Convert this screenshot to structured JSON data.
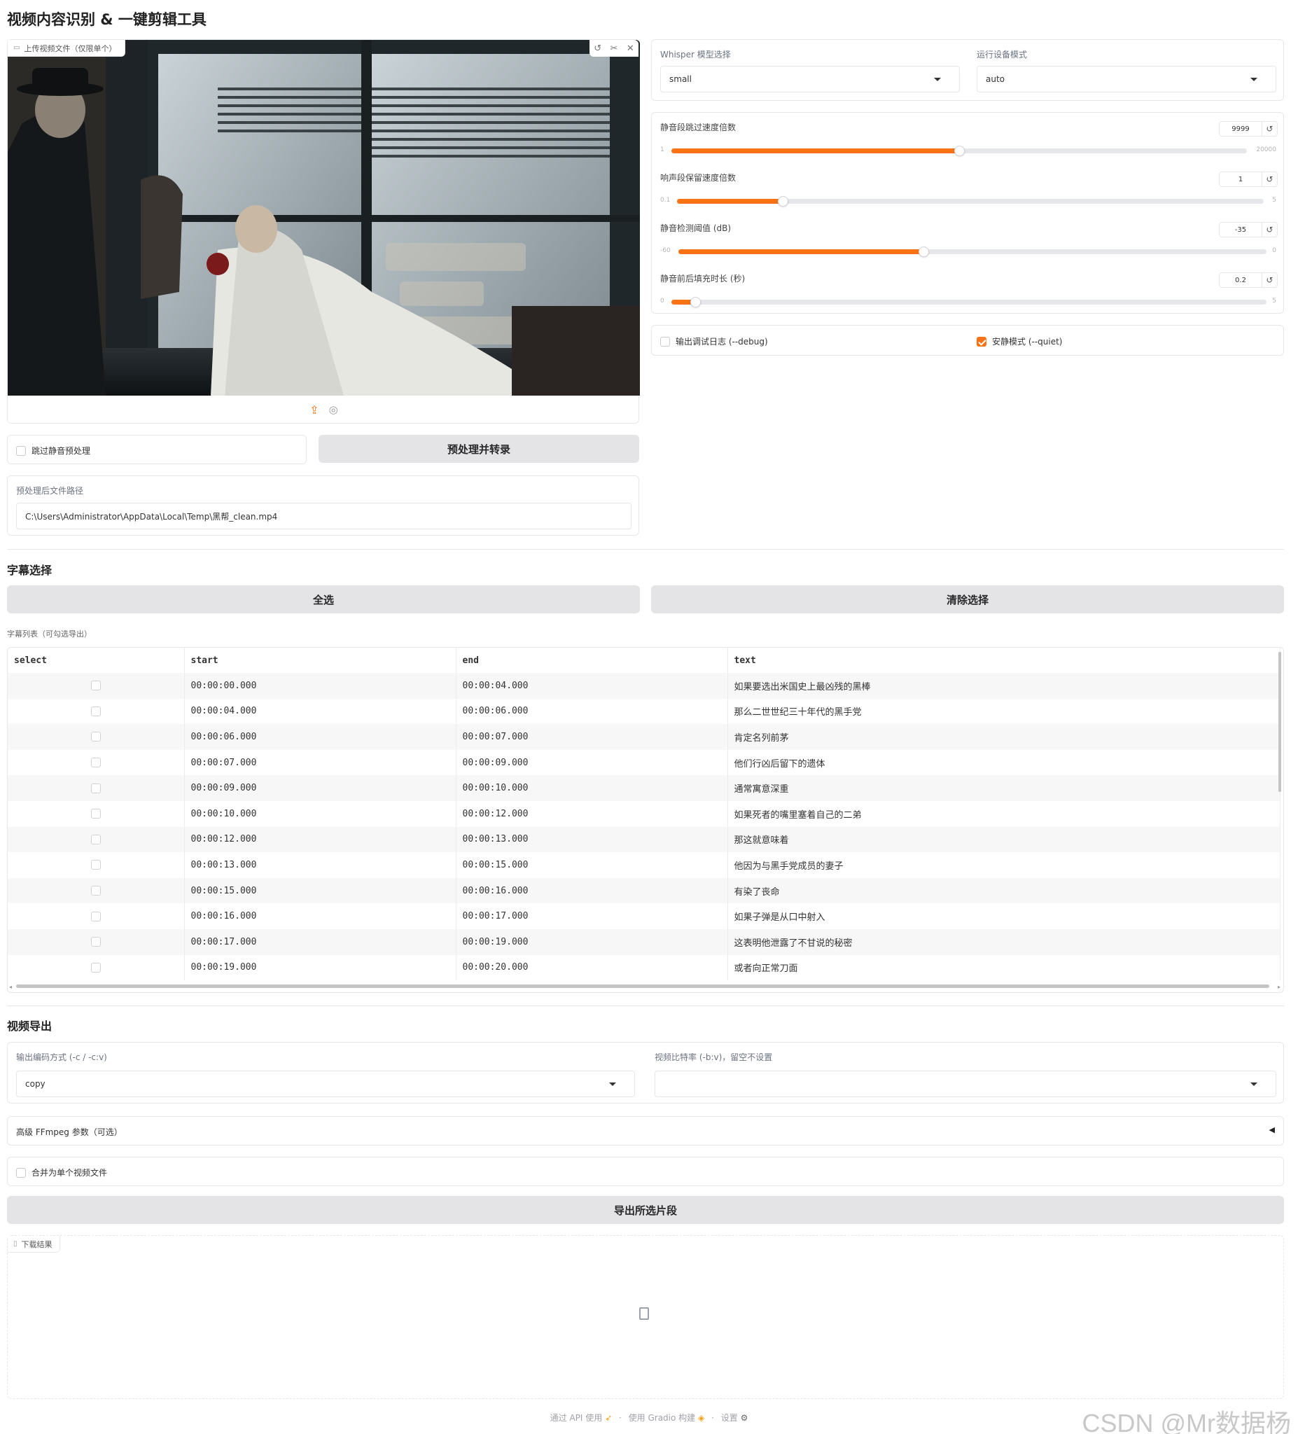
{
  "app": {
    "title": "视频内容识别 & 一键剪辑工具"
  },
  "upload": {
    "label": "上传视频文件（仅限单个）"
  },
  "model": {
    "label": "Whisper 模型选择",
    "value": "small"
  },
  "device": {
    "label": "运行设备模式",
    "value": "auto"
  },
  "sliders": [
    {
      "label": "静音段跳过速度倍数",
      "value": "9999",
      "min": "1",
      "max": "20000",
      "fraction": 0.5
    },
    {
      "label": "响声段保留速度倍数",
      "value": "1",
      "min": "0.1",
      "max": "5",
      "fraction": 0.18
    },
    {
      "label": "静音检测阈值 (dB)",
      "value": "-35",
      "min": "-60",
      "max": "0",
      "fraction": 0.417
    },
    {
      "label": "静音前后填充时长 (秒)",
      "value": "0.2",
      "min": "0",
      "max": "5",
      "fraction": 0.04
    }
  ],
  "options": {
    "debug_label": "输出调试日志 (--debug)",
    "debug_checked": false,
    "quiet_label": "安静模式 (--quiet)",
    "quiet_checked": true
  },
  "preprocess": {
    "skip_label": "跳过静音预处理",
    "button": "预处理并转录"
  },
  "path": {
    "label": "预处理后文件路径",
    "value": "C:\\Users\\Administrator\\AppData\\Local\\Temp\\黑帮_clean.mp4"
  },
  "subtitles": {
    "section_title": "字幕选择",
    "select_all": "全选",
    "clear": "清除选择",
    "list_label": "字幕列表（可勾选导出）",
    "columns": [
      "select",
      "start",
      "end",
      "text"
    ],
    "rows": [
      {
        "start": "00:00:00.000",
        "end": "00:00:04.000",
        "text": "如果要选出米国史上最凶残的黑棒"
      },
      {
        "start": "00:00:04.000",
        "end": "00:00:06.000",
        "text": "那么二世世纪三十年代的黑手党"
      },
      {
        "start": "00:00:06.000",
        "end": "00:00:07.000",
        "text": "肯定名列前茅"
      },
      {
        "start": "00:00:07.000",
        "end": "00:00:09.000",
        "text": "他们行凶后留下的遗体"
      },
      {
        "start": "00:00:09.000",
        "end": "00:00:10.000",
        "text": "通常寓意深重"
      },
      {
        "start": "00:00:10.000",
        "end": "00:00:12.000",
        "text": "如果死者的嘴里塞着自己的二弟"
      },
      {
        "start": "00:00:12.000",
        "end": "00:00:13.000",
        "text": "那这就意味着"
      },
      {
        "start": "00:00:13.000",
        "end": "00:00:15.000",
        "text": "他因为与黑手党成员的妻子"
      },
      {
        "start": "00:00:15.000",
        "end": "00:00:16.000",
        "text": "有染了丧命"
      },
      {
        "start": "00:00:16.000",
        "end": "00:00:17.000",
        "text": "如果子弹是从口中射入"
      },
      {
        "start": "00:00:17.000",
        "end": "00:00:19.000",
        "text": "这表明他泄露了不甘说的秘密"
      },
      {
        "start": "00:00:19.000",
        "end": "00:00:20.000",
        "text": "或者向正常刀面"
      }
    ]
  },
  "export": {
    "section_title": "视频导出",
    "codec_label": "输出编码方式 (-c / -c:v)",
    "codec_value": "copy",
    "bitrate_label": "视频比特率 (-b:v)，留空不设置",
    "bitrate_value": "",
    "advanced_label": "高级 FFmpeg 参数（可选）",
    "merge_label": "合并为单个视频文件",
    "export_button": "导出所选片段",
    "download_label": "下载结果"
  },
  "footer": {
    "api": "通过 API 使用",
    "built": "使用 Gradio 构建",
    "settings": "设置",
    "sep": "·"
  },
  "watermark": "CSDN @Mr数据杨",
  "colors": {
    "accent": "#f97316",
    "button_bg": "#e4e4e7",
    "border": "#e5e7eb"
  }
}
